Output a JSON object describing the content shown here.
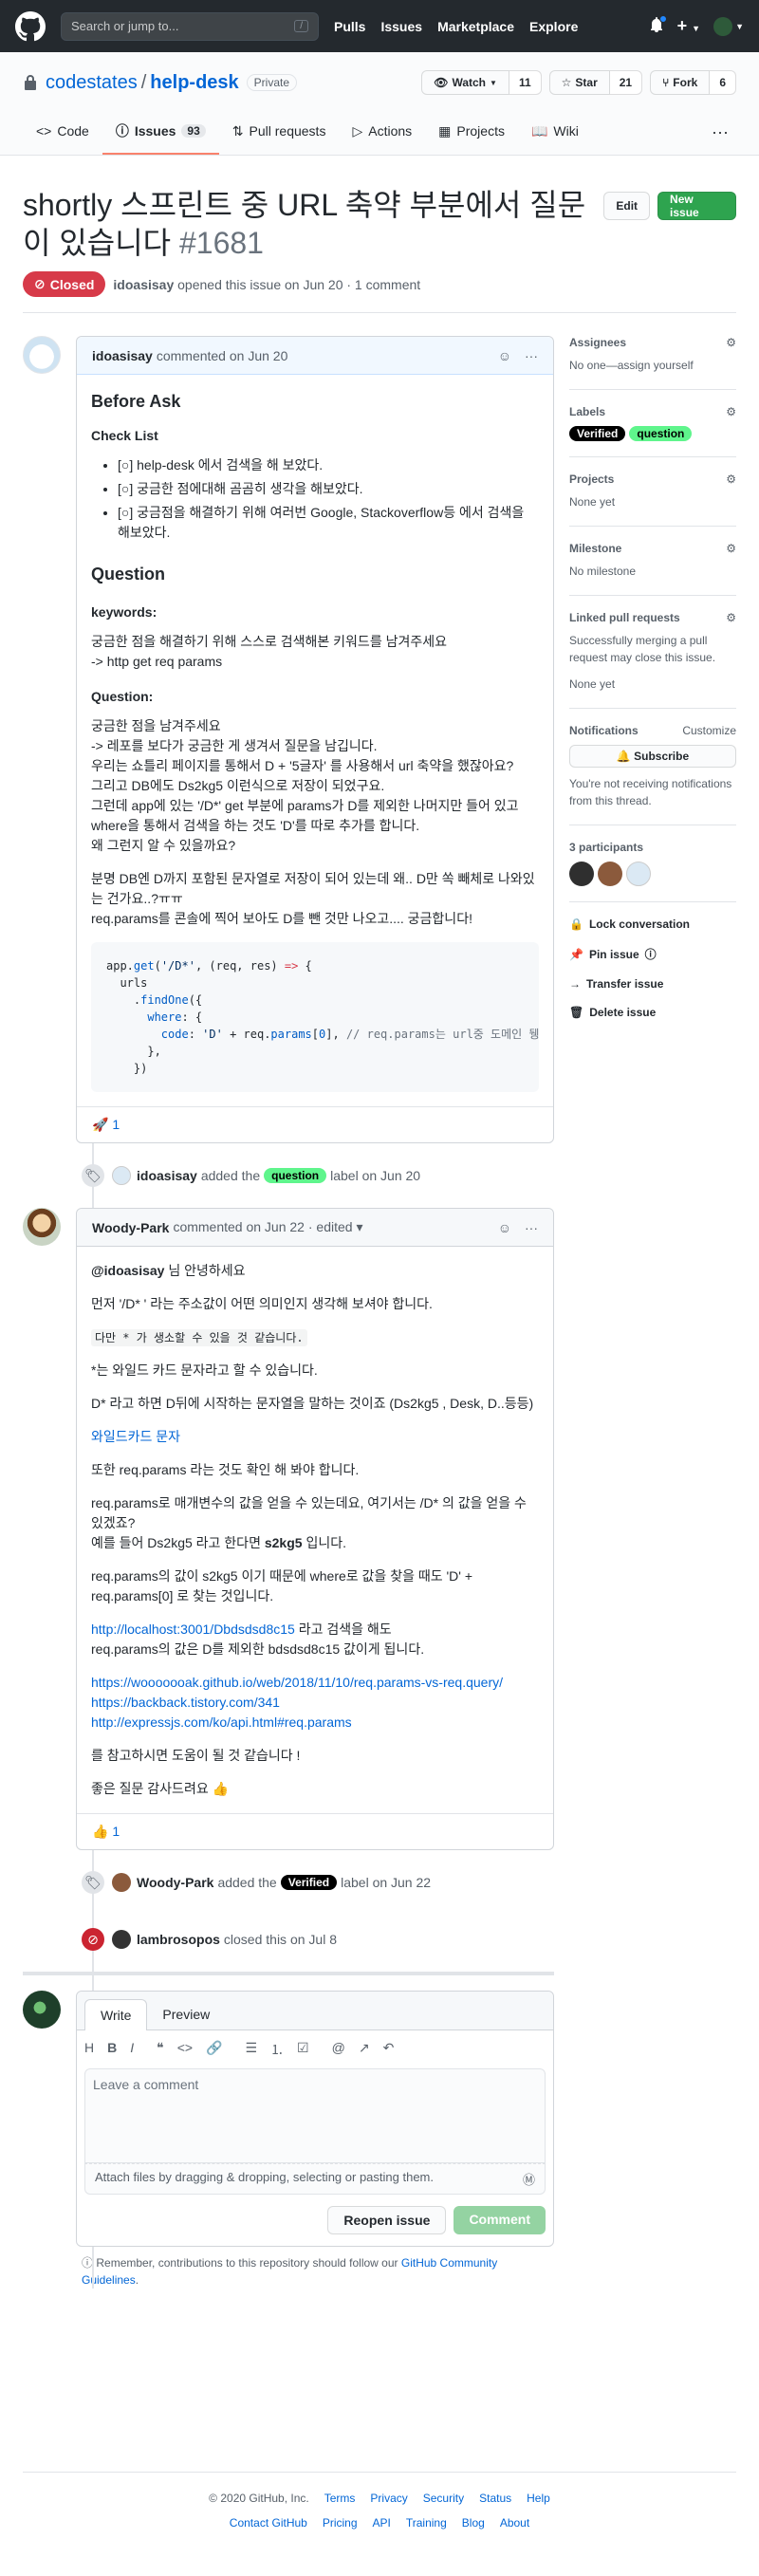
{
  "header": {
    "search_placeholder": "Search or jump to...",
    "slash": "/",
    "nav": [
      "Pulls",
      "Issues",
      "Marketplace",
      "Explore"
    ],
    "plus": "+"
  },
  "repo": {
    "owner": "codestates",
    "sep": "/",
    "name": "help-desk",
    "visibility": "Private",
    "watch_label": "Watch",
    "watch_count": "11",
    "star_label": "Star",
    "star_count": "21",
    "fork_label": "Fork",
    "fork_count": "6",
    "tabs": [
      {
        "label": "Code"
      },
      {
        "label": "Issues",
        "count": "93"
      },
      {
        "label": "Pull requests"
      },
      {
        "label": "Actions"
      },
      {
        "label": "Projects"
      },
      {
        "label": "Wiki"
      }
    ],
    "more": "···"
  },
  "issue": {
    "title": "shortly 스프린트 중 URL 축약 부분에서 질문이 있습니다",
    "number": "#1681",
    "edit_label": "Edit",
    "new_issue_label": "New issue",
    "state": "Closed",
    "author": "idoasisay",
    "meta": "opened this issue on Jun 20 · 1 comment"
  },
  "comment1": {
    "author": "idoasisay",
    "when": "commented on Jun 20",
    "h_before": "Before Ask",
    "h_checklist": "Check List",
    "checks": [
      "[○] help-desk 에서 검색을 해 보았다.",
      "[○] 궁금한 점에대해 곰곰히 생각을 해보았다.",
      "[○] 궁금점을 해결하기 위해 여러번 Google, Stackoverflow등 에서 검색을 해보았다."
    ],
    "h_question": "Question",
    "h_keywords": "keywords:",
    "keywords_1": "궁금한 점을 해결하기 위해 스스로 검색해본 키워드를 남겨주세요",
    "keywords_2": "-> http get req params",
    "h_question2": "Question:",
    "q_lines": [
      "궁금한 점을 남겨주세요",
      "-> 레포를 보다가 궁금한 게 생겨서 질문을 남깁니다.",
      "우리는 쇼틀리 페이지를 통해서 D + '5글자' 를 사용해서 url 축약을 했잖아요?",
      "그리고 DB에도 Ds2kg5 이런식으로 저장이 되었구요.",
      "그런데 app에 있는 '/D*' get 부분에 params가 D를 제외한 나머지만 들어 있고",
      "where을 통해서 검색을 하는 것도 'D'를 따로 추가를 합니다.",
      "왜 그런지 알 수 있을까요?"
    ],
    "q_extra_1": "분명 DB엔 D까지 포함된 문자열로 저장이 되어 있는데 왜.. D만 쏙 빼체로 나와있는 건가요..?ㅠㅠ",
    "q_extra_2": "req.params를 콘솔에 찍어 보아도 D를 뺀 것만 나오고.... 궁금합니다!",
    "reaction_emoji": "🚀",
    "reaction_count": "1"
  },
  "event1": {
    "actor": "idoasisay",
    "pre": "added the",
    "label": "question",
    "post": "label on Jun 20"
  },
  "comment2": {
    "author": "Woody-Park",
    "when": "commented on Jun 22 · edited ▾",
    "mention": "@idoasisay",
    "greet": "님 안녕하세요",
    "p1": "먼저 '/D* ' 라는 주소값이 어떤 의미인지 생각해 보셔야 합니다.",
    "p2": "다만 * 가 생소할 수 있을 것 같습니다.",
    "p3": "*는 와일드 카드 문자라고 할 수 있습니다.",
    "p4": "D* 라고 하면 D뒤에 시작하는 문자열을 말하는 것이죠 (Ds2kg5 , Desk, D..등등)",
    "link_wildcard": "와일드카드 문자",
    "p5": "또한 req.params 라는 것도 확인 해 봐야 합니다.",
    "p6a": "req.params로 매개변수의 값을 얻을 수 있는데요, 여기서는 /D* 의 값을 얻을 수 있겠죠?",
    "p6b_pre": "예를 들어 Ds2kg5 라고 한다면",
    "p6b_bold": "s2kg5",
    "p6b_post": "입니다.",
    "p7": "req.params의 값이 s2kg5 이기 때문에 where로 값을 찾을 때도 'D' + req.params[0] 로 찾는 것입니다.",
    "p8_link": "http://localhost:3001/Dbdsdsd8c15",
    "p8_rest": "라고 검색을 해도",
    "p8b": "req.params의 값은 D를 제외한 bdsdsd8c15 값이게 됩니다.",
    "links": [
      "https://wooooooak.github.io/web/2018/11/10/req.params-vs-req.query/",
      "https://backback.tistory.com/341",
      "http://expressjs.com/ko/api.html#req.params"
    ],
    "p9": "를 참고하시면 도움이 될 것 같습니다 !",
    "p10": "좋은 질문 감사드려요 👍",
    "reaction_emoji": "👍",
    "reaction_count": "1"
  },
  "event2": {
    "actor": "Woody-Park",
    "pre": "added the",
    "label": "Verified",
    "post": "label on Jun 22"
  },
  "event3": {
    "actor": "lambrosopos",
    "post": "closed this on Jul 8"
  },
  "new_comment": {
    "tab_write": "Write",
    "tab_preview": "Preview",
    "placeholder": "Leave a comment",
    "attach": "Attach files by dragging & dropping, selecting or pasting them.",
    "reopen": "Reopen issue",
    "comment": "Comment",
    "guide_pre": "Remember, contributions to this repository should follow our",
    "guide_link": "GitHub Community Guidelines",
    "guide_post": "."
  },
  "sidebar": {
    "assignees": "Assignees",
    "assignees_text": "No one—assign yourself",
    "labels": "Labels",
    "label1": "Verified",
    "label2": "question",
    "projects": "Projects",
    "projects_text": "None yet",
    "milestone": "Milestone",
    "milestone_text": "No milestone",
    "linked": "Linked pull requests",
    "linked_text": "Successfully merging a pull request may close this issue.",
    "linked_none": "None yet",
    "notifications": "Notifications",
    "customize": "Customize",
    "subscribe": "Subscribe",
    "notif_text": "You're not receiving notifications from this thread.",
    "participants": "3 participants",
    "lock": "Lock conversation",
    "pin": "Pin issue",
    "transfer": "Transfer issue",
    "delete": "Delete issue"
  },
  "footer": {
    "copy": "© 2020 GitHub, Inc.",
    "row1": [
      "Terms",
      "Privacy",
      "Security",
      "Status",
      "Help"
    ],
    "row2": [
      "Contact GitHub",
      "Pricing",
      "API",
      "Training",
      "Blog",
      "About"
    ]
  },
  "colors": {
    "closed": "#d73a49",
    "green": "#2ea44f",
    "link": "#0366d6",
    "question": "#5ff58c",
    "verified": "#000000"
  }
}
